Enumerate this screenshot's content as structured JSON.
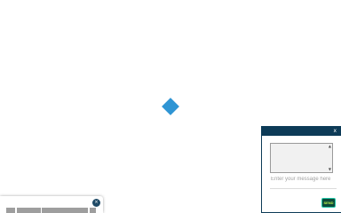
{
  "loader": {
    "icon": "diamond-loader-icon",
    "color": "#2f95d4"
  },
  "chat": {
    "header_color": "#0d3b57",
    "close_symbol": "x",
    "input_placeholder": "Enter your message here",
    "send_label": "SEND",
    "send_colors": {
      "background": "#0d4a3a",
      "border": "#22c7a8",
      "text": "#b8f24a"
    }
  },
  "bottom_panel": {
    "close_symbol": "×",
    "button_a_label": "",
    "button_b_label": "",
    "field_value": "",
    "button_c_label": ""
  }
}
